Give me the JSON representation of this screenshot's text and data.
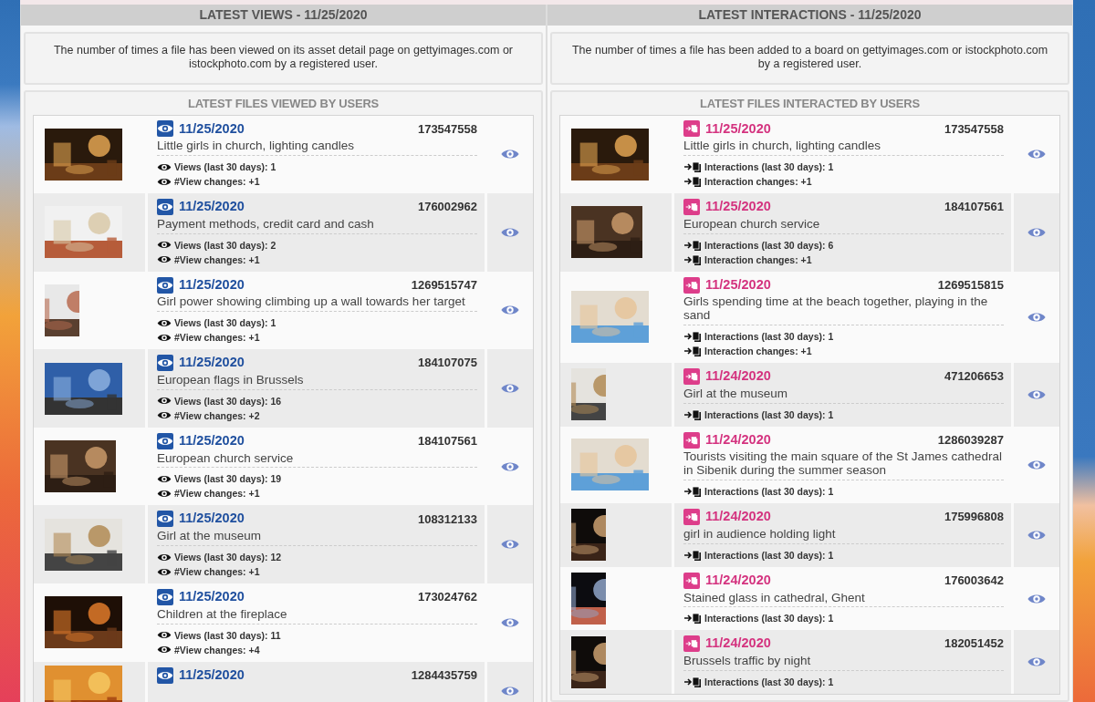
{
  "columns": [
    {
      "kind": "views",
      "header": "LATEST VIEWS - 11/25/2020",
      "description": "The number of times a file has been viewed on its asset detail page on gettyimages.com or istockphoto.com by a registered user.",
      "list_title": "LATEST FILES VIEWED BY USERS",
      "files": [
        {
          "date": "11/25/2020",
          "id": "173547558",
          "title": "Little girls in church, lighting candles",
          "stats": [
            "Views (last 30 days): 1",
            "#View changes: +1"
          ]
        },
        {
          "date": "11/25/2020",
          "id": "176002962",
          "title": "Payment methods, credit card and cash",
          "stats": [
            "Views (last 30 days): 2",
            "#View changes: +1"
          ]
        },
        {
          "date": "11/25/2020",
          "id": "1269515747",
          "title": "Girl power showing climbing up a wall towards her target",
          "stats": [
            "Views (last 30 days): 1",
            "#View changes: +1"
          ]
        },
        {
          "date": "11/25/2020",
          "id": "184107075",
          "title": "European flags in Brussels",
          "stats": [
            "Views (last 30 days): 16",
            "#View changes: +2"
          ]
        },
        {
          "date": "11/25/2020",
          "id": "184107561",
          "title": "European church service",
          "stats": [
            "Views (last 30 days): 19",
            "#View changes: +1"
          ]
        },
        {
          "date": "11/25/2020",
          "id": "108312133",
          "title": "Girl at the museum",
          "stats": [
            "Views (last 30 days): 12",
            "#View changes: +1"
          ]
        },
        {
          "date": "11/25/2020",
          "id": "173024762",
          "title": "Children at the fireplace",
          "stats": [
            "Views (last 30 days): 11",
            "#View changes: +4"
          ]
        },
        {
          "date": "11/25/2020",
          "id": "1284435759"
        }
      ]
    },
    {
      "kind": "interactions",
      "header": "LATEST INTERACTIONS - 11/25/2020",
      "description": "The number of times a file has been added to a board on gettyimages.com or istockphoto.com by a registered user.",
      "list_title": "LATEST FILES INTERACTED BY USERS",
      "files": [
        {
          "date": "11/25/2020",
          "id": "173547558",
          "title": "Little girls in church, lighting candles",
          "stats": [
            "Interactions (last 30 days): 1",
            "Interaction changes: +1"
          ]
        },
        {
          "date": "11/25/2020",
          "id": "184107561",
          "title": "European church service",
          "stats": [
            "Interactions (last 30 days): 6",
            "Interaction changes: +1"
          ]
        },
        {
          "date": "11/25/2020",
          "id": "1269515815",
          "title": "Girls spending time at the beach together, playing in the sand",
          "stats": [
            "Interactions (last 30 days): 1",
            "Interaction changes: +1"
          ]
        },
        {
          "date": "11/24/2020",
          "id": "471206653",
          "title": "Girl at the museum",
          "stats": [
            "Interactions (last 30 days): 1"
          ]
        },
        {
          "date": "11/24/2020",
          "id": "1286039287",
          "title": "Tourists visiting the main square of the St James cathedral in Sibenik during the summer season",
          "stats": [
            "Interactions (last 30 days): 1"
          ]
        },
        {
          "date": "11/24/2020",
          "id": "175996808",
          "title": "girl in audience holding light",
          "stats": [
            "Interactions (last 30 days): 1"
          ]
        },
        {
          "date": "11/24/2020",
          "id": "176003642",
          "title": "Stained glass in cathedral, Ghent",
          "stats": [
            "Interactions (last 30 days): 1"
          ]
        },
        {
          "date": "11/24/2020",
          "id": "182051452",
          "title": "Brussels traffic by night",
          "stats": [
            "Interactions (last 30 days): 1"
          ]
        }
      ]
    }
  ]
}
